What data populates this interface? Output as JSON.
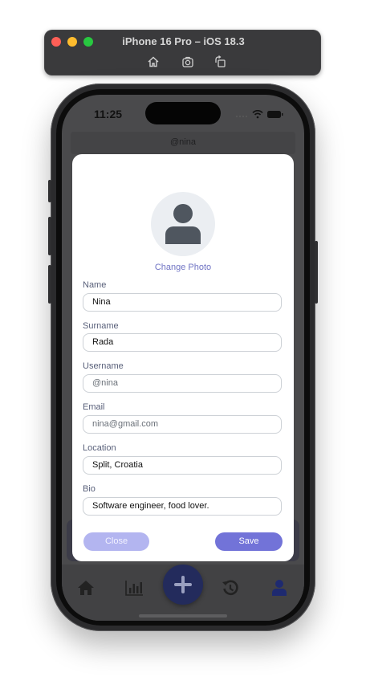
{
  "simulator": {
    "title": "iPhone 16 Pro – iOS 18.3",
    "tools": [
      "home-icon",
      "screenshot-icon",
      "rotate-icon"
    ]
  },
  "status_bar": {
    "time": "11:25",
    "icons": [
      "signal-icon",
      "wifi-icon",
      "battery-icon"
    ]
  },
  "background": {
    "username": "@nina"
  },
  "modal": {
    "change_photo": "Change Photo",
    "fields": {
      "name": {
        "label": "Name",
        "value": "Nina"
      },
      "surname": {
        "label": "Surname",
        "value": "Rada"
      },
      "username": {
        "label": "Username",
        "value": "@nina"
      },
      "email": {
        "label": "Email",
        "value": "nina@gmail.com"
      },
      "location": {
        "label": "Location",
        "value": "Split, Croatia"
      },
      "bio": {
        "label": "Bio",
        "value": "Software engineer, food lover."
      }
    },
    "close_label": "Close",
    "save_label": "Save"
  },
  "tabbar": {
    "items": [
      "home-icon",
      "bar-chart-icon",
      "plus-icon",
      "history-icon",
      "person-icon"
    ]
  },
  "colors": {
    "accent": "#7273d8",
    "accent_light": "#b3b5f0",
    "link": "#7074c4",
    "fab": "#232b5c"
  }
}
